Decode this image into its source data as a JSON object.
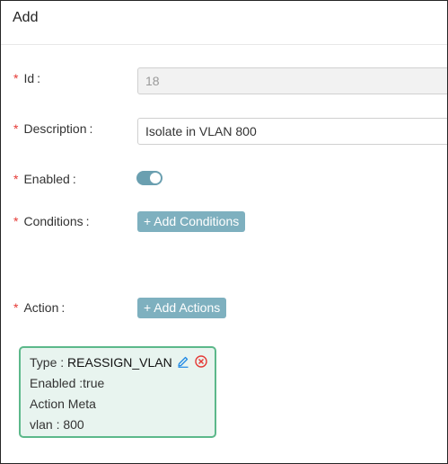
{
  "dialog": {
    "title": "Add"
  },
  "form": {
    "required_marker": "*",
    "id": {
      "label": "Id",
      "colon": ":",
      "value": "18"
    },
    "description": {
      "label": "Description",
      "colon": ":",
      "value": "Isolate in VLAN 800"
    },
    "enabled": {
      "label": "Enabled",
      "colon": ":",
      "state": "on"
    },
    "conditions": {
      "label": "Conditions",
      "colon": ":",
      "button": "+ Add Conditions"
    },
    "action": {
      "label": "Action",
      "colon": ":",
      "button": "+ Add Actions"
    }
  },
  "action_card": {
    "type_label": "Type :",
    "type_value": "REASSIGN_VLAN",
    "enabled_text": "Enabled :true",
    "meta_heading": "Action Meta",
    "vlan_text": "vlan : 800",
    "edit_icon": "pencil-icon",
    "delete_icon": "close-circle-icon"
  },
  "colors": {
    "accent": "#7eb0bf",
    "toggle_on": "#6a9fb0",
    "required": "#e53935",
    "card_border": "#5cb88a",
    "card_background": "#e8f4ef",
    "edit_icon": "#1e88e5",
    "delete_icon": "#e53935"
  }
}
